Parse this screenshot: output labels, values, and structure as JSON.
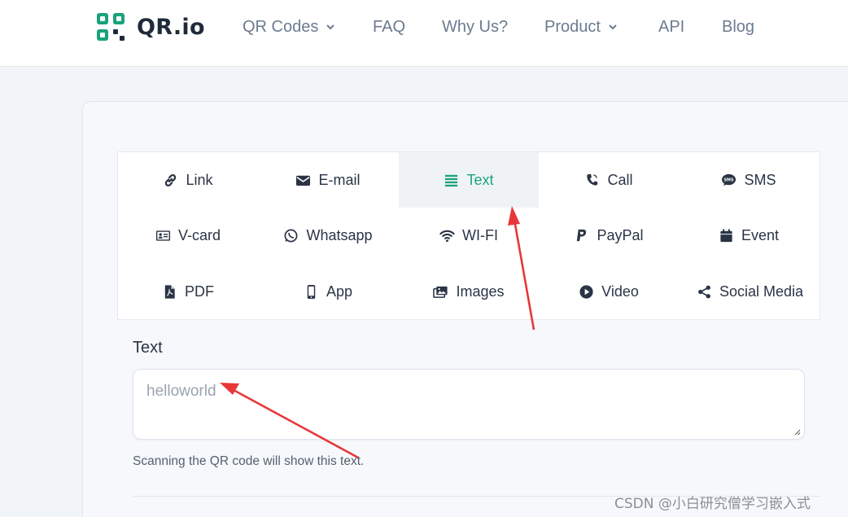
{
  "header": {
    "logo_text": "QR.io",
    "nav": [
      {
        "label": "QR Codes",
        "dropdown": true
      },
      {
        "label": "FAQ",
        "dropdown": false
      },
      {
        "label": "Why Us?",
        "dropdown": false
      },
      {
        "label": "Product",
        "dropdown": true
      },
      {
        "label": "API",
        "dropdown": false
      },
      {
        "label": "Blog",
        "dropdown": false
      }
    ]
  },
  "types": [
    {
      "label": "Link",
      "icon": "link-icon",
      "active": false
    },
    {
      "label": "E-mail",
      "icon": "envelope-icon",
      "active": false
    },
    {
      "label": "Text",
      "icon": "text-lines-icon",
      "active": true
    },
    {
      "label": "Call",
      "icon": "phone-icon",
      "active": false
    },
    {
      "label": "SMS",
      "icon": "sms-bubble-icon",
      "active": false
    },
    {
      "label": "V-card",
      "icon": "id-card-icon",
      "active": false
    },
    {
      "label": "Whatsapp",
      "icon": "whatsapp-icon",
      "active": false
    },
    {
      "label": "WI-FI",
      "icon": "wifi-icon",
      "active": false
    },
    {
      "label": "PayPal",
      "icon": "paypal-icon",
      "active": false
    },
    {
      "label": "Event",
      "icon": "calendar-icon",
      "active": false
    },
    {
      "label": "PDF",
      "icon": "pdf-file-icon",
      "active": false
    },
    {
      "label": "App",
      "icon": "mobile-icon",
      "active": false
    },
    {
      "label": "Images",
      "icon": "images-icon",
      "active": false
    },
    {
      "label": "Video",
      "icon": "play-circle-icon",
      "active": false
    },
    {
      "label": "Social Media",
      "icon": "share-icon",
      "active": false
    }
  ],
  "form": {
    "label": "Text",
    "value": "helloworld",
    "help": "Scanning the QR code will show this text."
  },
  "watermark": "CSDN @小白研究僧学习嵌入式",
  "colors": {
    "accent": "#1aa27a",
    "annotation_arrow": "#e8373a",
    "text_dark": "#2a3445",
    "nav_text": "#6c7b90"
  }
}
